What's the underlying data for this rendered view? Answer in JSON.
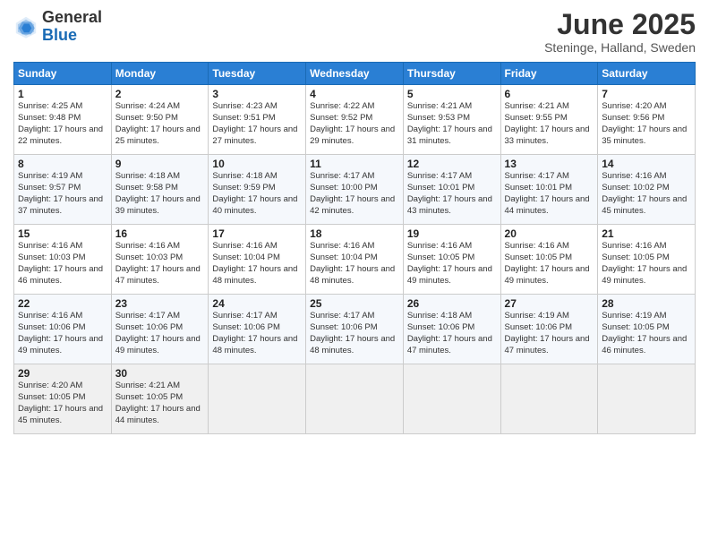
{
  "header": {
    "logo_general": "General",
    "logo_blue": "Blue",
    "month_title": "June 2025",
    "location": "Steninge, Halland, Sweden"
  },
  "days_of_week": [
    "Sunday",
    "Monday",
    "Tuesday",
    "Wednesday",
    "Thursday",
    "Friday",
    "Saturday"
  ],
  "weeks": [
    [
      {
        "num": "1",
        "sr": "4:25 AM",
        "ss": "9:48 PM",
        "dh": "17 hours and 22 minutes."
      },
      {
        "num": "2",
        "sr": "4:24 AM",
        "ss": "9:50 PM",
        "dh": "17 hours and 25 minutes."
      },
      {
        "num": "3",
        "sr": "4:23 AM",
        "ss": "9:51 PM",
        "dh": "17 hours and 27 minutes."
      },
      {
        "num": "4",
        "sr": "4:22 AM",
        "ss": "9:52 PM",
        "dh": "17 hours and 29 minutes."
      },
      {
        "num": "5",
        "sr": "4:21 AM",
        "ss": "9:53 PM",
        "dh": "17 hours and 31 minutes."
      },
      {
        "num": "6",
        "sr": "4:21 AM",
        "ss": "9:55 PM",
        "dh": "17 hours and 33 minutes."
      },
      {
        "num": "7",
        "sr": "4:20 AM",
        "ss": "9:56 PM",
        "dh": "17 hours and 35 minutes."
      }
    ],
    [
      {
        "num": "8",
        "sr": "4:19 AM",
        "ss": "9:57 PM",
        "dh": "17 hours and 37 minutes."
      },
      {
        "num": "9",
        "sr": "4:18 AM",
        "ss": "9:58 PM",
        "dh": "17 hours and 39 minutes."
      },
      {
        "num": "10",
        "sr": "4:18 AM",
        "ss": "9:59 PM",
        "dh": "17 hours and 40 minutes."
      },
      {
        "num": "11",
        "sr": "4:17 AM",
        "ss": "10:00 PM",
        "dh": "17 hours and 42 minutes."
      },
      {
        "num": "12",
        "sr": "4:17 AM",
        "ss": "10:01 PM",
        "dh": "17 hours and 43 minutes."
      },
      {
        "num": "13",
        "sr": "4:17 AM",
        "ss": "10:01 PM",
        "dh": "17 hours and 44 minutes."
      },
      {
        "num": "14",
        "sr": "4:16 AM",
        "ss": "10:02 PM",
        "dh": "17 hours and 45 minutes."
      }
    ],
    [
      {
        "num": "15",
        "sr": "4:16 AM",
        "ss": "10:03 PM",
        "dh": "17 hours and 46 minutes."
      },
      {
        "num": "16",
        "sr": "4:16 AM",
        "ss": "10:03 PM",
        "dh": "17 hours and 47 minutes."
      },
      {
        "num": "17",
        "sr": "4:16 AM",
        "ss": "10:04 PM",
        "dh": "17 hours and 48 minutes."
      },
      {
        "num": "18",
        "sr": "4:16 AM",
        "ss": "10:04 PM",
        "dh": "17 hours and 48 minutes."
      },
      {
        "num": "19",
        "sr": "4:16 AM",
        "ss": "10:05 PM",
        "dh": "17 hours and 49 minutes."
      },
      {
        "num": "20",
        "sr": "4:16 AM",
        "ss": "10:05 PM",
        "dh": "17 hours and 49 minutes."
      },
      {
        "num": "21",
        "sr": "4:16 AM",
        "ss": "10:05 PM",
        "dh": "17 hours and 49 minutes."
      }
    ],
    [
      {
        "num": "22",
        "sr": "4:16 AM",
        "ss": "10:06 PM",
        "dh": "17 hours and 49 minutes."
      },
      {
        "num": "23",
        "sr": "4:17 AM",
        "ss": "10:06 PM",
        "dh": "17 hours and 49 minutes."
      },
      {
        "num": "24",
        "sr": "4:17 AM",
        "ss": "10:06 PM",
        "dh": "17 hours and 48 minutes."
      },
      {
        "num": "25",
        "sr": "4:17 AM",
        "ss": "10:06 PM",
        "dh": "17 hours and 48 minutes."
      },
      {
        "num": "26",
        "sr": "4:18 AM",
        "ss": "10:06 PM",
        "dh": "17 hours and 47 minutes."
      },
      {
        "num": "27",
        "sr": "4:19 AM",
        "ss": "10:06 PM",
        "dh": "17 hours and 47 minutes."
      },
      {
        "num": "28",
        "sr": "4:19 AM",
        "ss": "10:05 PM",
        "dh": "17 hours and 46 minutes."
      }
    ],
    [
      {
        "num": "29",
        "sr": "4:20 AM",
        "ss": "10:05 PM",
        "dh": "17 hours and 45 minutes."
      },
      {
        "num": "30",
        "sr": "4:21 AM",
        "ss": "10:05 PM",
        "dh": "17 hours and 44 minutes."
      },
      null,
      null,
      null,
      null,
      null
    ]
  ]
}
